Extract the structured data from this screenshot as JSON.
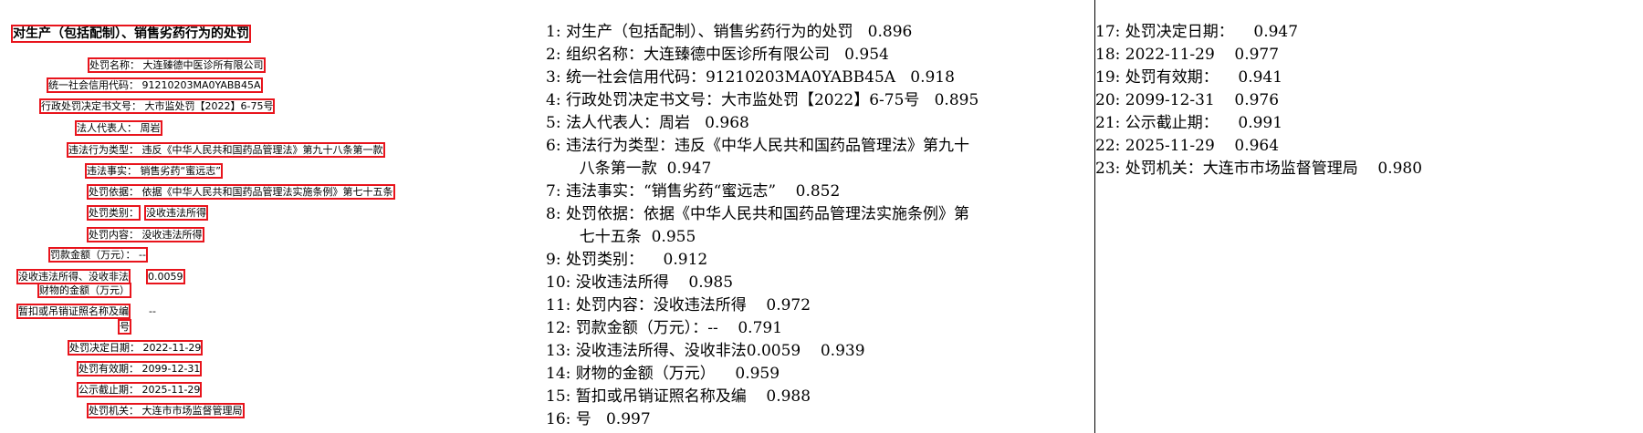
{
  "detections": [
    {
      "text": "对生产（包括配制）、销售劣药行为的处罚"
    },
    {
      "text": "处罚名称：  大连臻德中医诊所有限公司"
    },
    {
      "text": "统一社会信用代码：  91210203MA0YABB45A"
    },
    {
      "text": "行政处罚决定书文号：  大市监处罚【2022】6-75号"
    },
    {
      "text": "法人代表人：  周岩"
    },
    {
      "text": "违法行为类型：  违反《中华人民共和国药品管理法》第九十八条第一款"
    },
    {
      "text": "违法事实：  销售劣药“蜜远志”"
    },
    {
      "text": "处罚依据：  依据《中华人民共和国药品管理法实施条例》第七十五条"
    },
    {
      "text": "处罚类别："
    },
    {
      "text": "没收违法所得"
    },
    {
      "text": "处罚内容：  没收违法所得"
    },
    {
      "text": "罚款金额（万元）：  --"
    },
    {
      "text": "没收违法所得、没收非法"
    },
    {
      "text": "0.0059"
    },
    {
      "text": "财物的金额（万元）"
    },
    {
      "text": "暂扣或吊销证照名称及编"
    },
    {
      "text": "--"
    },
    {
      "text": "号"
    },
    {
      "text": "处罚决定日期：  2022-11-29"
    },
    {
      "text": "处罚有效期：  2099-12-31"
    },
    {
      "text": "公示截止期：  2025-11-29"
    },
    {
      "text": "处罚机关：  大连市市场监督管理局"
    }
  ],
  "results_col1": [
    "1: 对生产（包括配制）、销售劣药行为的处罚   0.896",
    "2: 组织名称：大连臻德中医诊所有限公司   0.954",
    "3: 统一社会信用代码：91210203MA0YABB45A   0.918",
    "4: 行政处罚决定书文号：大市监处罚【2022】6-75号   0.895",
    "5: 法人代表人：周岩   0.968",
    "6: 违法行为类型：违反《中华人民共和国药品管理法》第九十",
    "  八条第一款  0.947",
    "7: 违法事实：“销售劣药“蜜远志”    0.852",
    "8: 处罚依据：依据《中华人民共和国药品管理法实施条例》第",
    "  七十五条  0.955",
    "9: 处罚类别：    0.912",
    "10: 没收违法所得    0.985",
    "11: 处罚内容：没收违法所得    0.972",
    "12: 罚款金额（万元）：--    0.791",
    "13: 没收违法所得、没收非法0.0059    0.939",
    "14: 财物的金额（万元）    0.959",
    "15: 暂扣或吊销证照名称及编    0.988",
    "16: 号   0.997"
  ],
  "results_col2": [
    "17: 处罚决定日期：    0.947",
    "18: 2022-11-29    0.977",
    "19: 处罚有效期：    0.941",
    "20: 2099-12-31    0.976",
    "21: 公示截止期：    0.991",
    "22: 2025-11-29    0.964",
    "23: 处罚机关：大连市市场监督管理局    0.980"
  ],
  "colors": {
    "box": "#e8141c",
    "text": "#000000",
    "divider": "#000000"
  }
}
